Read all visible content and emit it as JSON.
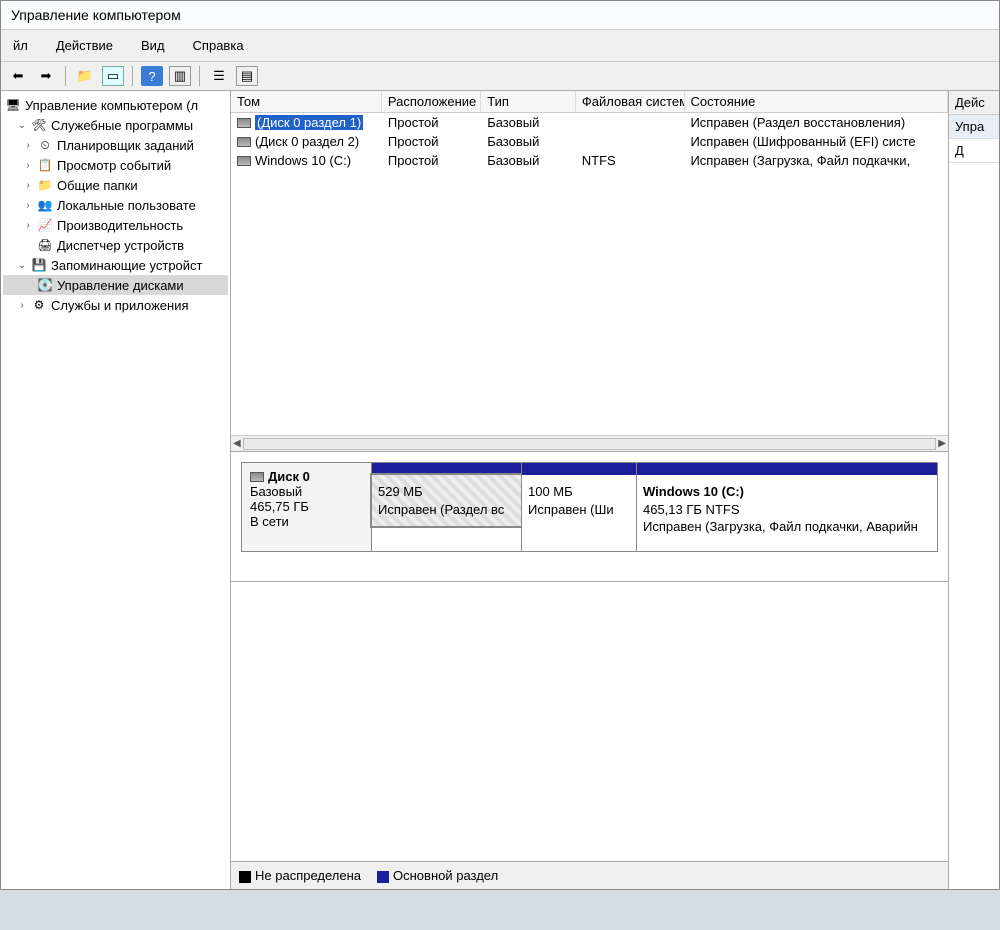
{
  "title": "Управление компьютером",
  "menu": {
    "file": "йл",
    "action": "Действие",
    "view": "Вид",
    "help": "Справка"
  },
  "tree": {
    "root": "Управление компьютером (л",
    "system_tools": "Служебные программы",
    "task_scheduler": "Планировщик заданий",
    "event_viewer": "Просмотр событий",
    "shared_folders": "Общие папки",
    "local_users": "Локальные пользовате",
    "performance": "Производительность",
    "device_manager": "Диспетчер устройств",
    "storage": "Запоминающие устройст",
    "disk_mgmt": "Управление дисками",
    "services_apps": "Службы и приложения"
  },
  "cols": {
    "name": "Том",
    "layout": "Расположение",
    "type": "Тип",
    "fs": "Файловая система",
    "status": "Состояние"
  },
  "vols": [
    {
      "name": "(Диск 0 раздел 1)",
      "layout": "Простой",
      "type": "Базовый",
      "fs": "",
      "status": "Исправен (Раздел восстановления)"
    },
    {
      "name": "(Диск 0 раздел 2)",
      "layout": "Простой",
      "type": "Базовый",
      "fs": "",
      "status": "Исправен (Шифрованный (EFI) систе"
    },
    {
      "name": "Windows 10 (C:)",
      "layout": "Простой",
      "type": "Базовый",
      "fs": "NTFS",
      "status": "Исправен (Загрузка, Файл подкачки,"
    }
  ],
  "disk": {
    "title": "Диск 0",
    "type": "Базовый",
    "size": "465,75 ГБ",
    "online": "В сети",
    "parts": [
      {
        "line1": "529 МБ",
        "line2": "Исправен (Раздел вс"
      },
      {
        "line1": "100 МБ",
        "line2": "Исправен (Ши"
      },
      {
        "title": "Windows 10  (C:)",
        "line1": "465,13 ГБ NTFS",
        "line2": "Исправен (Загрузка, Файл подкачки, Аварийн"
      }
    ]
  },
  "legend": {
    "unalloc": "Не распределена",
    "primary": "Основной раздел"
  },
  "actions": {
    "header": "Дейс",
    "item1": "Упра",
    "item2": "Д"
  }
}
